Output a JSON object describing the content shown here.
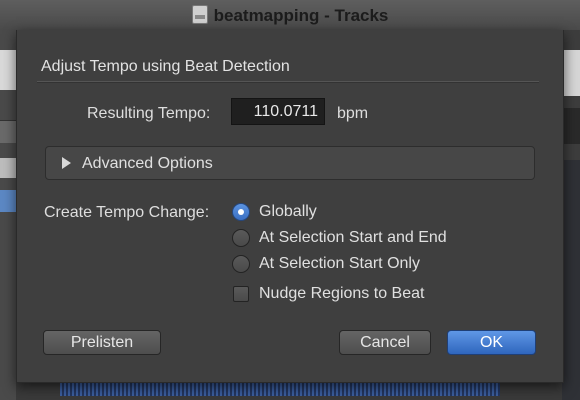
{
  "window": {
    "title": "beatmapping - Tracks"
  },
  "dialog": {
    "title": "Adjust Tempo using Beat Detection",
    "resulting_tempo": {
      "label": "Resulting Tempo:",
      "value": "110.0711",
      "unit": "bpm"
    },
    "advanced_options": {
      "label": "Advanced Options",
      "expanded": false
    },
    "tempo_change": {
      "label": "Create Tempo Change:",
      "options": [
        {
          "label": "Globally",
          "selected": true
        },
        {
          "label": "At Selection Start and End",
          "selected": false
        },
        {
          "label": "At Selection Start Only",
          "selected": false
        }
      ],
      "nudge": {
        "label": "Nudge Regions to Beat",
        "checked": false
      }
    },
    "buttons": {
      "prelisten": "Prelisten",
      "cancel": "Cancel",
      "ok": "OK"
    }
  },
  "colors": {
    "accent": "#3a6fc3",
    "sheet_bg": "#3f3f3f"
  }
}
